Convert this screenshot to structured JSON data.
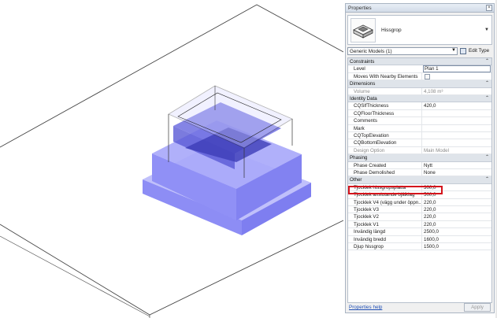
{
  "panel": {
    "title": "Properties",
    "close_glyph": "×",
    "type_name": "Hissgrop",
    "filter_value": "Generic Models (1)",
    "edit_type_label": "Edit Type",
    "help_link": "Properties help",
    "apply_label": "Apply"
  },
  "sections": {
    "constraints": "Constraints",
    "dimensions": "Dimensions",
    "identity": "Identity Data",
    "phasing": "Phasing",
    "other": "Other"
  },
  "props": {
    "level_k": "Level",
    "level_v": "Plan 1",
    "moves_k": "Moves With Nearby Elements",
    "volume_k": "Volume",
    "volume_v": "4,108 m³",
    "cqsf_k": "CQSlfThickness",
    "cqsf_v": "420,0",
    "cqfloor_k": "CQFloorThickness",
    "cqfloor_v": "",
    "comments_k": "Comments",
    "comments_v": "",
    "mark_k": "Mark",
    "mark_v": "",
    "cqtop_k": "CQTopElevation",
    "cqtop_v": "",
    "cqbottom_k": "CQBottomElevation",
    "cqbottom_v": "",
    "design_k": "Design Option",
    "design_v": "Main Model",
    "phase_created_k": "Phase Created",
    "phase_created_v": "Nytt",
    "phase_demolished_k": "Phase Demolished",
    "phase_demolished_v": "None",
    "t_platta_k": "Tjocklek hissgropsplatta",
    "t_platta_v": "300,0",
    "t_anslut_k": "Tjocklek anslutande bjälklag",
    "t_anslut_v": "500,0",
    "t_v4_k": "Tjocklek V4 (vägg under öppn...",
    "t_v4_v": "220,0",
    "t_v3_k": "Tjocklek V3",
    "t_v3_v": "220,0",
    "t_v2_k": "Tjocklek V2",
    "t_v2_v": "220,0",
    "t_v1_k": "Tjocklek V1",
    "t_v1_v": "220,0",
    "inv_langd_k": "Invändig längd",
    "inv_langd_v": "2500,0",
    "inv_bredd_k": "Invändig bredd",
    "inv_bredd_v": "1600,0",
    "djup_k": "Djup hissgrop",
    "djup_v": "1500,0"
  },
  "icons": {
    "close": "close-icon",
    "collapse": "chevron-up-icon",
    "dropdown": "chevron-down-icon",
    "edit_type": "edit-type-icon",
    "thumbnail": "generic-model-icon"
  },
  "colors": {
    "highlight": "#d4141c",
    "model_blue": "#7b7bf2",
    "section_header": "#dfe4ea"
  }
}
